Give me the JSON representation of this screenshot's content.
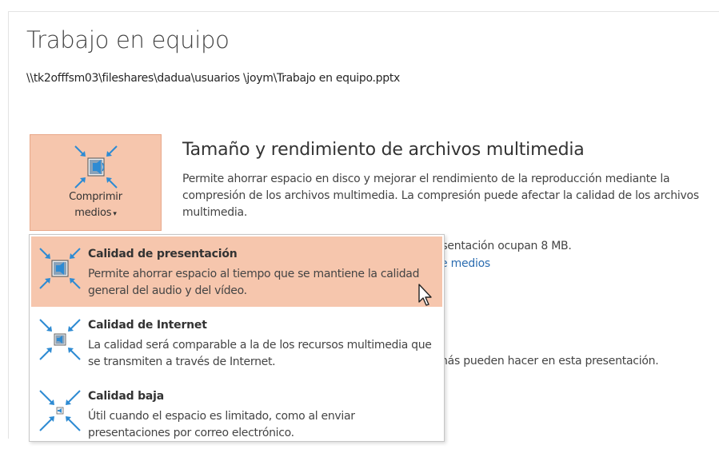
{
  "page": {
    "title": "Trabajo en equipo",
    "path": "\\\\tk2offfsm03\\fileshares\\dadua\\usuarios \\joym\\Trabajo en equipo.pptx"
  },
  "compress_button": {
    "line1": "Comprimir",
    "line2": "medios",
    "caret": "▾",
    "icon": "compress-media-icon"
  },
  "section": {
    "title": "Tamaño y rendimiento de archivos multimedia",
    "description": "Permite ahorrar espacio en disco y mejorar el rendimiento de la reproducción mediante la compresión de los archivos multimedia. La compresión puede afectar la calidad de los archivos multimedia."
  },
  "partially_hidden": {
    "size_text": "esentación ocupan 8 MB.",
    "link_text": "e medios",
    "permissions_text": "nás pueden hacer en esta presentación."
  },
  "dropdown": {
    "items": [
      {
        "title": "Calidad de presentación",
        "description": "Permite ahorrar espacio al tiempo que se mantiene la calidad general del audio y del vídeo.",
        "selected": true,
        "icon": "compress-media-icon"
      },
      {
        "title": "Calidad de Internet",
        "description": "La calidad será comparable a la de los recursos multimedia que se transmiten a través de Internet.",
        "selected": false,
        "icon": "compress-media-icon"
      },
      {
        "title": "Calidad baja",
        "description": "Útil cuando el espacio es limitado, como al enviar presentaciones por correo electrónico.",
        "selected": false,
        "icon": "compress-media-icon"
      }
    ]
  },
  "colors": {
    "accent_fill": "#f6c6ad",
    "accent_border": "#e8a88a",
    "arrow_blue": "#2e8bd3",
    "link_blue": "#2b6cb0"
  }
}
